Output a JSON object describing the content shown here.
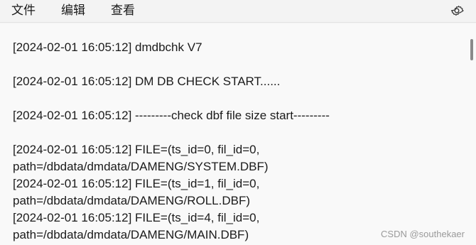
{
  "menu": {
    "file": "文件",
    "edit": "编辑",
    "view": "查看"
  },
  "settings_icon": "gear-icon",
  "editor": {
    "lines": [
      "[2024-02-01 16:05:12] dmdbchk V7",
      "",
      "[2024-02-01 16:05:12] DM DB CHECK START......",
      "",
      "[2024-02-01 16:05:12] ---------check dbf file size start---------",
      "",
      "[2024-02-01 16:05:12] FILE=(ts_id=0, fil_id=0,",
      "path=/dbdata/dmdata/DAMENG/SYSTEM.DBF)",
      "[2024-02-01 16:05:12] FILE=(ts_id=1, fil_id=0,",
      "path=/dbdata/dmdata/DAMENG/ROLL.DBF)",
      "[2024-02-01 16:05:12] FILE=(ts_id=4, fil_id=0,",
      "path=/dbdata/dmdata/DAMENG/MAIN.DBF)"
    ]
  },
  "watermark": "CSDN @southekaer",
  "colors": {
    "background": "#f9f9f9",
    "menubar": "#f3f3f3",
    "text": "#1b1b1b",
    "scrollbar": "#8a8a8a"
  }
}
